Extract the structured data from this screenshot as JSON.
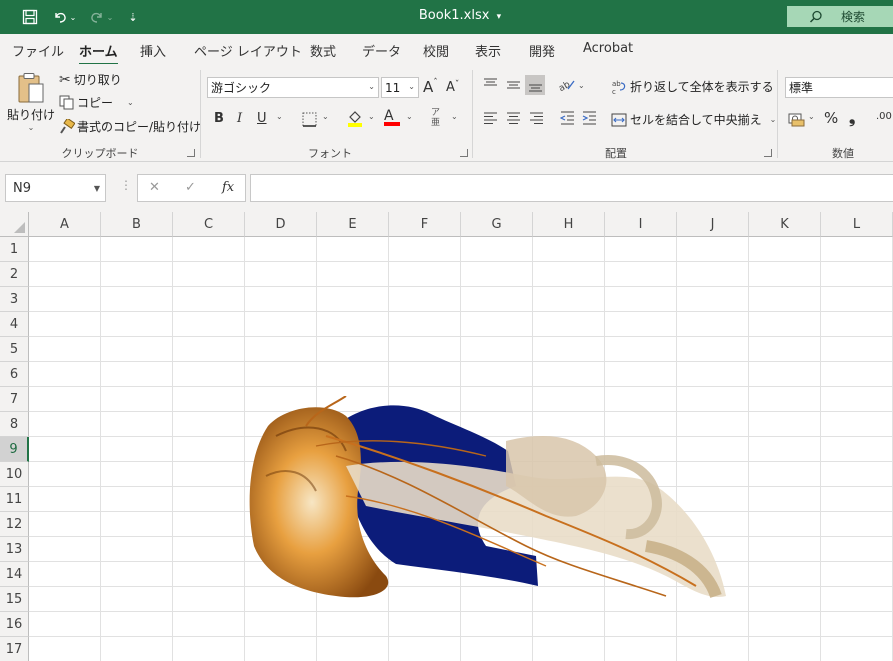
{
  "titlebar": {
    "filename": "Book1.xlsx",
    "filename_caret": "▾",
    "search_label": "検索",
    "qa_caret": "⌄",
    "customize_glyph": "⇣"
  },
  "tabs": [
    "ファイル",
    "ホーム",
    "挿入",
    "ページ レイアウト",
    "数式",
    "データ",
    "校閲",
    "表示",
    "開発",
    "Acrobat"
  ],
  "clipboard": {
    "paste_label": "貼り付け",
    "cut_label": "切り取り",
    "copy_label": "コピー",
    "format_painter_label": "書式のコピー/貼り付け",
    "group_label": "クリップボード"
  },
  "font": {
    "font_name": "游ゴシック",
    "font_size": "11",
    "grow_label": "A",
    "shrink_label": "A",
    "bold": "B",
    "italic": "I",
    "underline": "U",
    "font_color_letter": "A",
    "phonetic_top": "ア",
    "phonetic_bottom": "亜",
    "group_label": "フォント",
    "highlight_color": "#ffff00",
    "font_color": "#ff0000"
  },
  "alignment": {
    "wrap_text_label": "折り返して全体を表示する",
    "merge_label": "セルを結合して中央揃え",
    "group_label": "配置"
  },
  "number": {
    "format_value": "標準",
    "percent": "%",
    "comma": "❟",
    "increase_decimal": ".00",
    "group_label": "数値"
  },
  "formula_bar": {
    "name_box": "N9",
    "cancel_glyph": "✕",
    "enter_glyph": "✓",
    "fx_label": "fx",
    "formula": ""
  },
  "sheet": {
    "columns": [
      "A",
      "B",
      "C",
      "D",
      "E",
      "F",
      "G",
      "H",
      "I",
      "J",
      "K",
      "L"
    ],
    "rows": [
      "1",
      "2",
      "3",
      "4",
      "5",
      "6",
      "7",
      "8",
      "9",
      "10",
      "11",
      "12",
      "13",
      "14",
      "15",
      "16",
      "17"
    ],
    "selected_row": "9"
  },
  "colors": {
    "excel_green": "#217346",
    "ribbon_bg": "#f3f2f1",
    "jelly_bell": "#c97a1c",
    "jelly_background": "#0c1c7a"
  },
  "picture": {
    "subject": "jellyfish-image"
  }
}
